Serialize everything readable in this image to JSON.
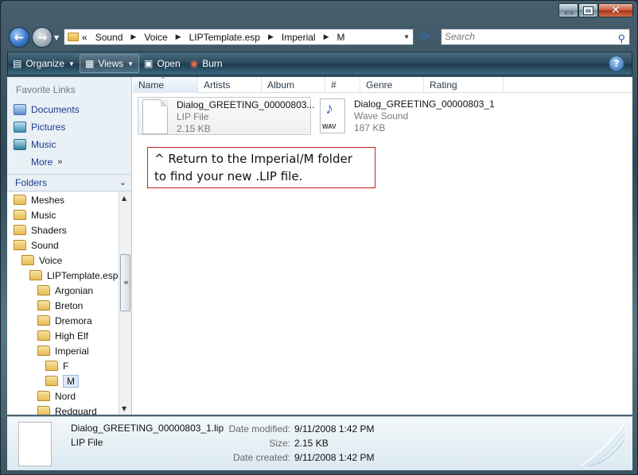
{
  "window": {
    "caption_buttons": {
      "minimize_icon": "minimize-icon",
      "maximize_icon": "maximize-icon",
      "close_icon": "close-icon"
    }
  },
  "address_bar": {
    "overflow": "«",
    "crumbs": [
      "Sound",
      "Voice",
      "LIPTemplate.esp",
      "Imperial",
      "M"
    ]
  },
  "search": {
    "placeholder": "Search"
  },
  "command_bar": {
    "organize": "Organize",
    "views": "Views",
    "open": "Open",
    "burn": "Burn",
    "help": "?"
  },
  "nav_pane": {
    "favorites_title": "Favorite Links",
    "favorites": [
      "Documents",
      "Pictures",
      "Music"
    ],
    "more": "More",
    "folders_title": "Folders",
    "tree": [
      {
        "label": "Meshes",
        "depth": 0
      },
      {
        "label": "Music",
        "depth": 0
      },
      {
        "label": "Shaders",
        "depth": 0
      },
      {
        "label": "Sound",
        "depth": 0
      },
      {
        "label": "Voice",
        "depth": 1
      },
      {
        "label": "LIPTemplate.esp",
        "depth": 2
      },
      {
        "label": "Argonian",
        "depth": 3
      },
      {
        "label": "Breton",
        "depth": 3
      },
      {
        "label": "Dremora",
        "depth": 3
      },
      {
        "label": "High Elf",
        "depth": 3
      },
      {
        "label": "Imperial",
        "depth": 3
      },
      {
        "label": "F",
        "depth": 4
      },
      {
        "label": "M",
        "depth": 4,
        "selected": true
      },
      {
        "label": "Nord",
        "depth": 3
      },
      {
        "label": "Redguard",
        "depth": 3
      }
    ]
  },
  "columns": [
    "Name",
    "Artists",
    "Album",
    "#",
    "Genre",
    "Rating"
  ],
  "files": [
    {
      "name": "Dialog_GREETING_00000803...",
      "type": "LIP File",
      "size": "2.15 KB",
      "selected": true
    },
    {
      "name": "Dialog_GREETING_00000803_1",
      "type": "Wave Sound",
      "size": "187 KB",
      "thumb_label": "WAV"
    }
  ],
  "annotation": {
    "line1": "^ Return to the Imperial/M folder",
    "line2": "to find your new .LIP file."
  },
  "details": {
    "file_name": "Dialog_GREETING_00000803_1.lip",
    "file_type": "LIP File",
    "date_modified_label": "Date modified:",
    "date_modified": "9/11/2008 1:42 PM",
    "size_label": "Size:",
    "size": "2.15 KB",
    "date_created_label": "Date created:",
    "date_created": "9/11/2008 1:42 PM"
  }
}
